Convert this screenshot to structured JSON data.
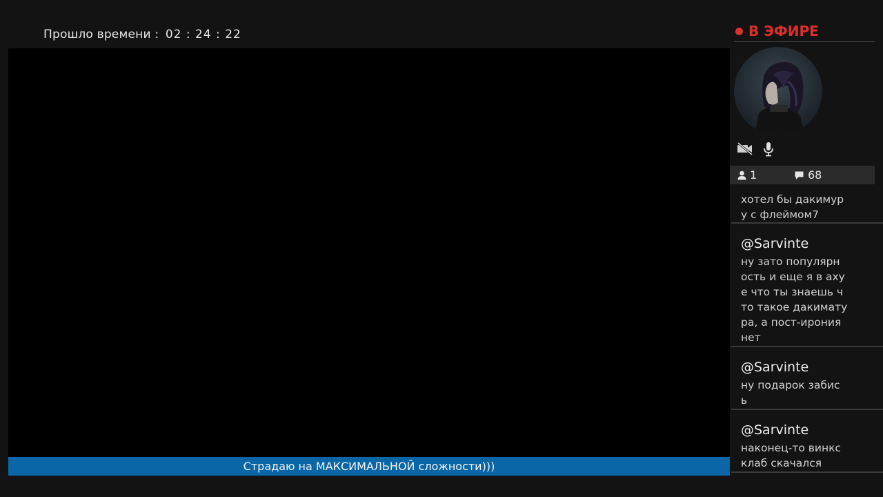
{
  "stream": {
    "elapsed_label": "Прошло времени :",
    "elapsed_time": "02 : 24 : 22",
    "title": "Страдаю на МАКСИМАЛЬНОЙ сложности)))"
  },
  "sidebar": {
    "live_label": "В ЭФИРЕ",
    "viewers": "1",
    "comments": "68",
    "icons": [
      "camera-off-icon",
      "microphone-icon",
      "person-icon",
      "speech-bubble-icon"
    ]
  },
  "chat": {
    "messages": [
      {
        "user": "",
        "text": "хотел бы дакимур\nу с флеймом7"
      },
      {
        "user": "@Sarvinte",
        "text": "ну зато популярн\nость и еще я в аху\nе что ты знаешь ч\nто такое дакимату\nра, а пост-ирония\nнет"
      },
      {
        "user": "@Sarvinte",
        "text": "ну подарок забис\nь"
      },
      {
        "user": "@Sarvinte",
        "text": "наконец-то винкс\nклаб скачался"
      }
    ]
  },
  "colors": {
    "live": "#d9302c",
    "title_bar": "#0a66a6",
    "background": "#131313"
  }
}
